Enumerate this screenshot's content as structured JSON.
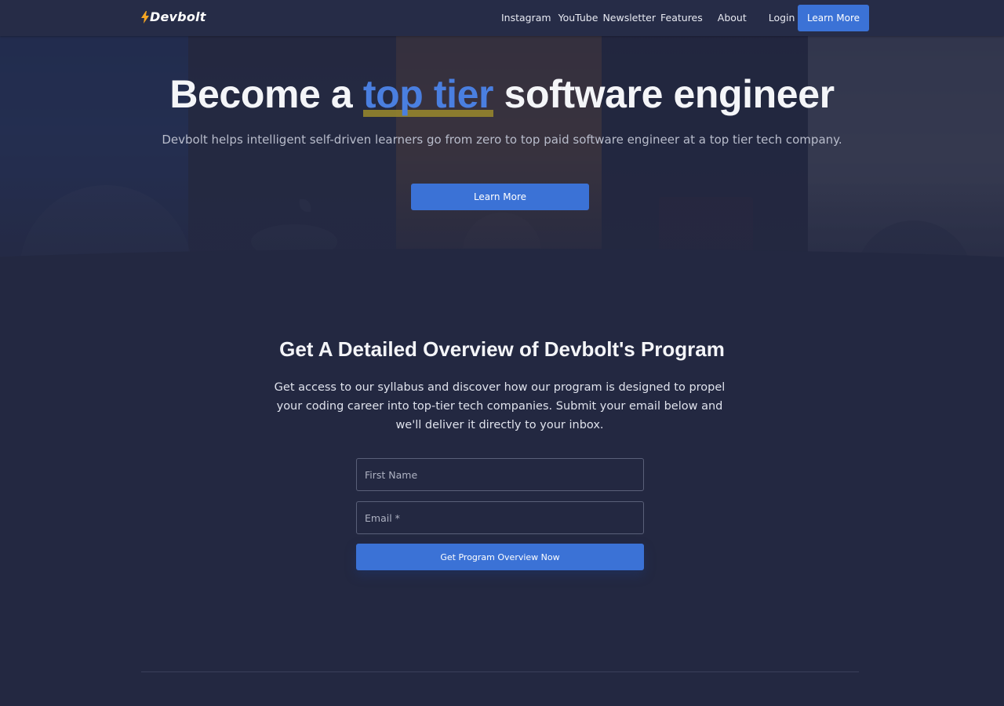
{
  "brand": {
    "name": "Devbolt",
    "accent": "#3b72d6",
    "bolt_color": "#f5a623"
  },
  "nav": {
    "links": [
      "Instagram",
      "YouTube",
      "Newsletter",
      "Features",
      "About",
      "Login"
    ],
    "cta_label": "Learn More"
  },
  "hero": {
    "title_before": "Become a ",
    "title_highlight": "top tier",
    "title_after": " software engineer",
    "subtitle": "Devbolt helps intelligent self-driven learners go from zero to top paid software engineer at a top tier tech company.",
    "button_label": "Learn More"
  },
  "overview": {
    "title": "Get A Detailed Overview of Devbolt's Program",
    "description": "Get access to our syllabus and discover how our program is designed to propel your coding career into top-tier tech companies. Submit your email below and we'll deliver it directly to your inbox.",
    "first_name_placeholder": "First Name",
    "email_placeholder": "Email *",
    "submit_label": "Get Program Overview Now"
  }
}
